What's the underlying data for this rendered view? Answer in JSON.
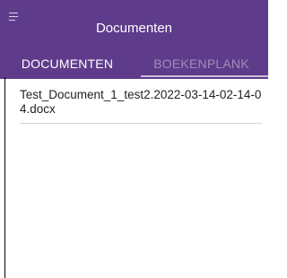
{
  "toolbar": {
    "menu_icon": "hamburger-menu-icon",
    "title": "Documenten",
    "background_color": "#5f3c8b"
  },
  "tabs": [
    {
      "label": "DOCUMENTEN",
      "selected": true
    },
    {
      "label": "BOEKENPLANK",
      "selected": false
    }
  ],
  "documents": [
    {
      "name": "Test_Document_1_test2.2022-03-14-02-14-04.docx"
    }
  ]
}
